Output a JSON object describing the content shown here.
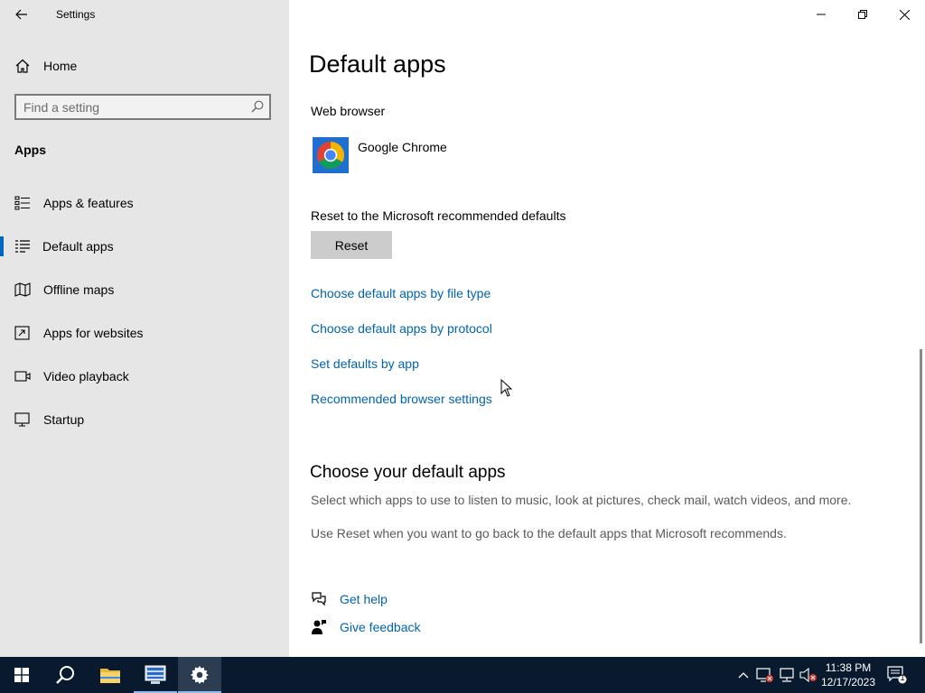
{
  "window": {
    "title": "Settings"
  },
  "sidebar": {
    "home_label": "Home",
    "search_placeholder": "Find a setting",
    "section": "Apps",
    "items": [
      {
        "label": "Apps & features",
        "icon": "apps-features-icon"
      },
      {
        "label": "Default apps",
        "icon": "default-apps-icon",
        "active": true
      },
      {
        "label": "Offline maps",
        "icon": "map-icon"
      },
      {
        "label": "Apps for websites",
        "icon": "apps-websites-icon"
      },
      {
        "label": "Video playback",
        "icon": "video-icon"
      },
      {
        "label": "Startup",
        "icon": "startup-icon"
      }
    ]
  },
  "main": {
    "title": "Default apps",
    "web_browser_label": "Web browser",
    "web_browser_app": "Google Chrome",
    "reset_label": "Reset to the Microsoft recommended defaults",
    "reset_button": "Reset",
    "links": [
      "Choose default apps by file type",
      "Choose default apps by protocol",
      "Set defaults by app",
      "Recommended browser settings"
    ],
    "section_title": "Choose your default apps",
    "desc1": "Select which apps to use to listen to music, look at pictures, check mail, watch videos, and more.",
    "desc2": "Use Reset when you want to go back to the default apps that Microsoft recommends.",
    "get_help": "Get help",
    "give_feedback": "Give feedback"
  },
  "taskbar": {
    "time": "11:38 PM",
    "date": "12/17/2023",
    "notification_count": "1"
  },
  "colors": {
    "accent": "#0067c0",
    "link": "#0063b1",
    "sidebar_bg": "#e6e6e6",
    "taskbar_bg": "#0a1a2e"
  }
}
